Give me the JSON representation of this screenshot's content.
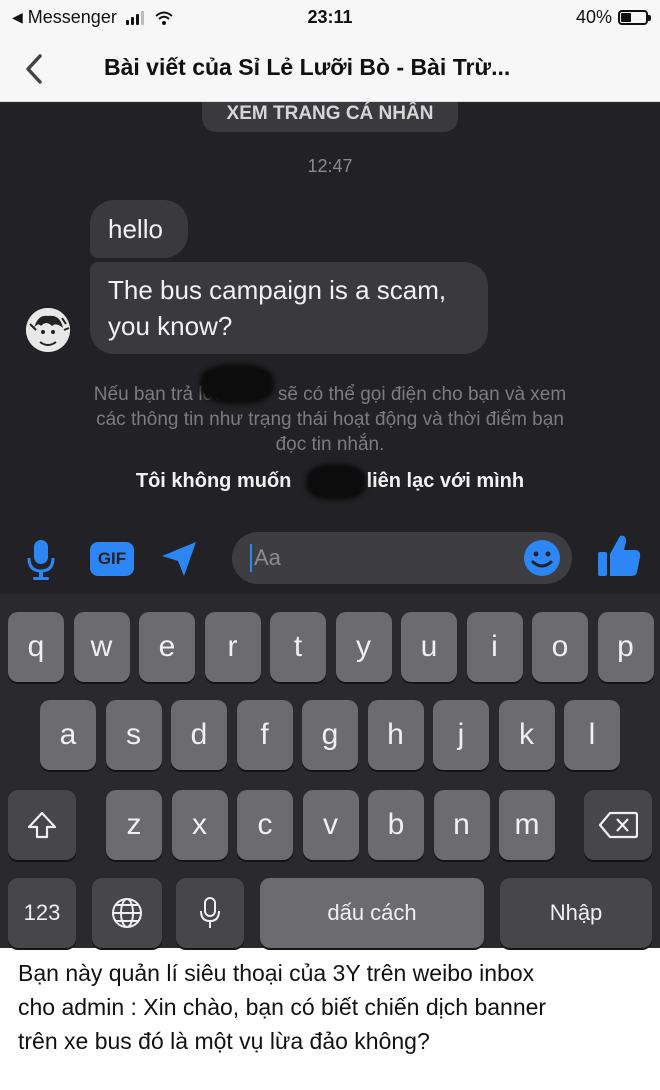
{
  "status_bar": {
    "back_app": "Messenger",
    "time": "23:11",
    "battery_text": "40%",
    "battery_level": 0.4
  },
  "nav": {
    "title": "Bài viết của Sỉ Lẻ Lưỡi Bò  - Bài Trừ..."
  },
  "chat": {
    "profile_button": "XEM TRANG CÁ NHÂN",
    "timestamp": "12:47",
    "messages": [
      {
        "text": "hello"
      },
      {
        "text_line1": "The bus campaign is a scam,",
        "text_line2": "you know?"
      }
    ],
    "notice": {
      "line1_a": "Nếu bạn trả lời",
      "line1_b": "sẽ có thể gọi điện cho bạn và xem",
      "line2_a": "các thông tin như",
      "line2_b": "trạng thái hoạt động và thời điểm bạn",
      "line3": "đọc tin nhắn."
    },
    "block_link_a": "Tôi không muốn",
    "block_link_b": "liên lạc với mình"
  },
  "composer": {
    "placeholder": "Aa",
    "icons": [
      "microphone-icon",
      "gif-icon",
      "location-arrow-icon",
      "emoji-icon",
      "thumbs-up-icon"
    ],
    "gif_label": "GIF",
    "accent": "#2d86f5"
  },
  "keyboard": {
    "row1": [
      "q",
      "w",
      "e",
      "r",
      "t",
      "y",
      "u",
      "i",
      "o",
      "p"
    ],
    "row2": [
      "a",
      "s",
      "d",
      "f",
      "g",
      "h",
      "j",
      "k",
      "l"
    ],
    "row3": [
      "z",
      "x",
      "c",
      "v",
      "b",
      "n",
      "m"
    ],
    "numbers_key": "123",
    "space_key": "dấu cách",
    "return_key": "Nhập"
  },
  "caption": {
    "line1": "Bạn này quản lí siêu thoại của 3Y trên weibo inbox",
    "line2": "cho admin : Xin chào, bạn có biết chiến dịch banner",
    "line3": "trên xe bus đó là một vụ lừa đảo không?"
  }
}
